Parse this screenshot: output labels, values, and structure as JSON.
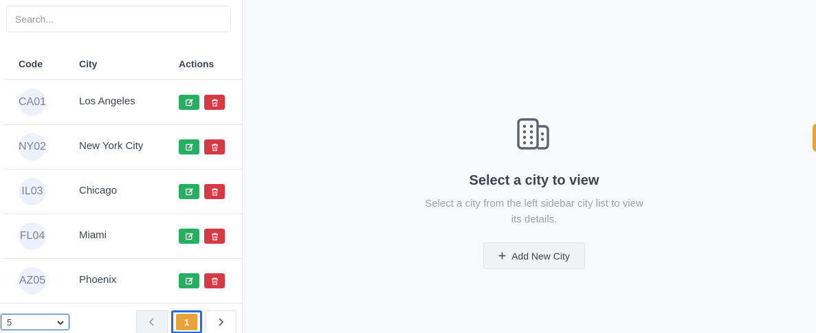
{
  "search": {
    "placeholder": "Search..."
  },
  "table": {
    "headers": {
      "code": "Code",
      "city": "City",
      "actions": "Actions"
    },
    "rows": [
      {
        "code": "CA01",
        "city": "Los Angeles"
      },
      {
        "code": "NY02",
        "city": "New York City"
      },
      {
        "code": "IL03",
        "city": "Chicago"
      },
      {
        "code": "FL04",
        "city": "Miami"
      },
      {
        "code": "AZ05",
        "city": "Phoenix"
      }
    ]
  },
  "pagination": {
    "page_size": "5",
    "current_page": "1"
  },
  "empty_state": {
    "icon": "building-icon",
    "title": "Select a city to view",
    "subtitle": "Select a city from the left sidebar city list to view its details.",
    "add_button": "Add New City"
  },
  "colors": {
    "edit": "#27ae60",
    "delete": "#d63a44",
    "accent": "#e8a43a",
    "focus": "#1d6fe0"
  }
}
